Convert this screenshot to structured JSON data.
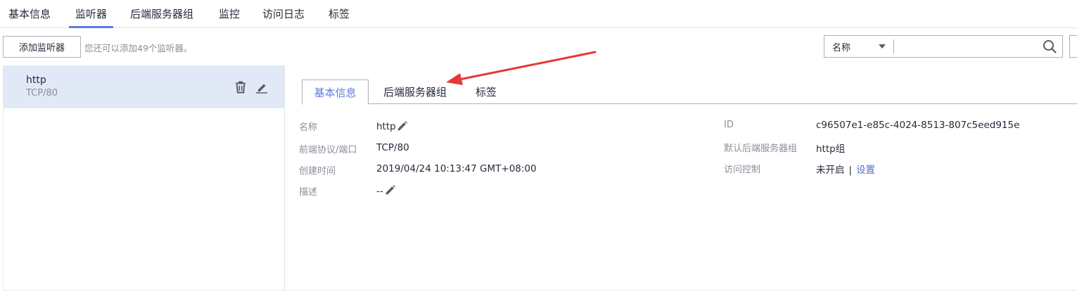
{
  "top_tabs": [
    "基本信息",
    "监听器",
    "后端服务器组",
    "监控",
    "访问日志",
    "标签"
  ],
  "toolbar": {
    "add_button": "添加监听器",
    "hint": "您还可以添加49个监听器。",
    "filter_selected": "名称",
    "search_value": ""
  },
  "listener": {
    "name": "http",
    "protocol_port": "TCP/80"
  },
  "inner_tabs": [
    "基本信息",
    "后端服务器组",
    "标签"
  ],
  "details": {
    "name_label": "名称",
    "name_value": "http",
    "frontend_label": "前端协议/端口",
    "frontend_value": "TCP/80",
    "created_label": "创建时间",
    "created_value": "2019/04/24 10:13:47 GMT+08:00",
    "desc_label": "描述",
    "desc_value": "--",
    "id_label": "ID",
    "id_value": "c96507e1-e85c-4024-8513-807c5eed915e",
    "default_group_label": "默认后端服务器组",
    "default_group_value": "http组",
    "access_control_label": "访问控制",
    "access_control_value": "未开启",
    "access_control_sep": "|",
    "access_control_link": "设置"
  },
  "colors": {
    "accent": "#5e7ce0",
    "link": "#526ecc",
    "selected_row": "#e1e9f7",
    "arrow": "#e53935"
  },
  "icons": [
    "trash-icon",
    "pencil-icon",
    "search-icon",
    "chevron-down-icon"
  ]
}
